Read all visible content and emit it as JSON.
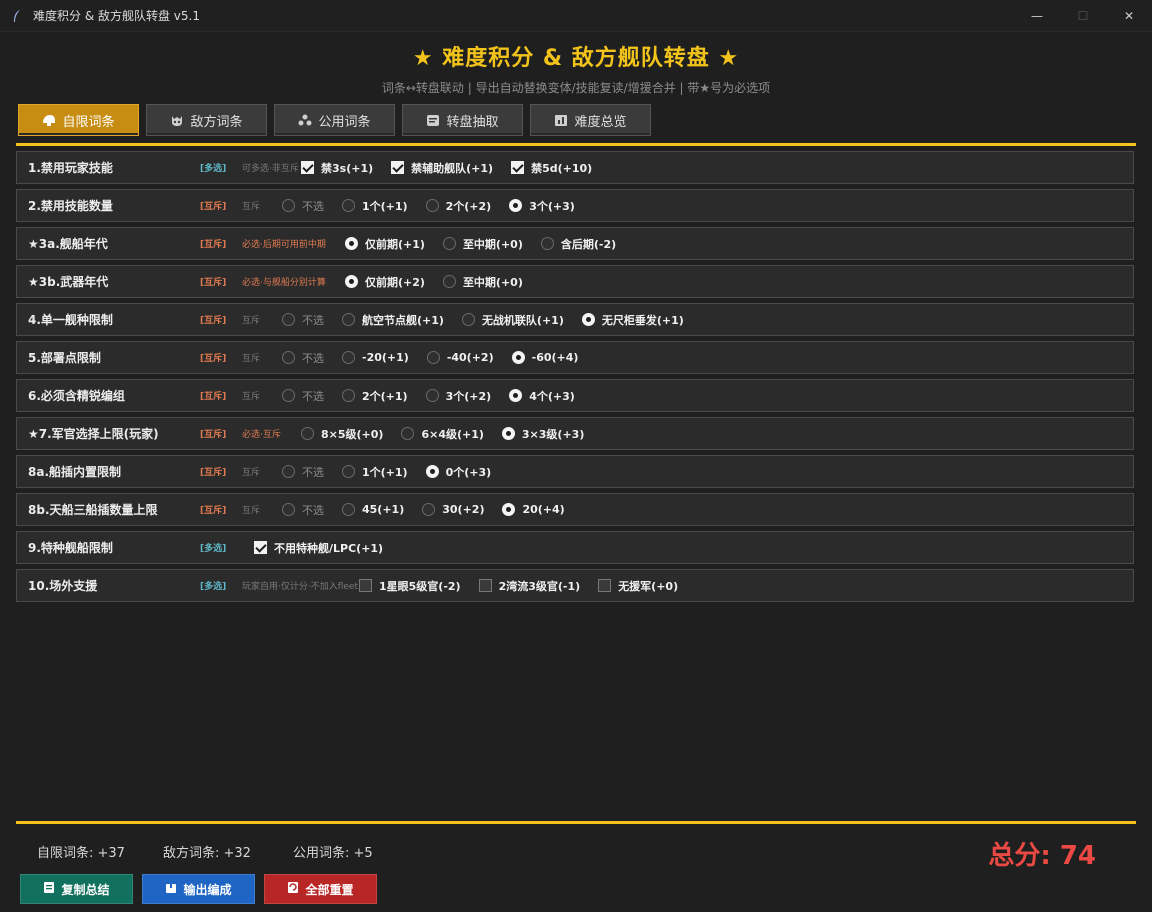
{
  "window": {
    "title": "难度积分 & 敌方舰队转盘 v5.1"
  },
  "header": {
    "title": "★ 难度积分 & 敌方舰队转盘 ★",
    "subtitle": "词条↔转盘联动 | 导出自动替换变体/技能复读/增援合并 | 带★号为必选项"
  },
  "tabs": [
    {
      "label": "自限词条",
      "icon": "helmet-icon",
      "active": true
    },
    {
      "label": "敌方词条",
      "icon": "skull-icon",
      "active": false
    },
    {
      "label": "公用词条",
      "icon": "puzzle-icon",
      "active": false
    },
    {
      "label": "转盘抽取",
      "icon": "dice-icon",
      "active": false
    },
    {
      "label": "难度总览",
      "icon": "chart-icon",
      "active": false
    }
  ],
  "rows": [
    {
      "label": "1.禁用玩家技能",
      "tag": "[多选]",
      "tag_type": "multi",
      "note": "可多选·非互斥",
      "note_req": false,
      "type": "check",
      "options": [
        {
          "label": "禁3s(+1)",
          "on": true
        },
        {
          "label": "禁辅助舰队(+1)",
          "on": true
        },
        {
          "label": "禁5d(+10)",
          "on": true
        }
      ]
    },
    {
      "label": "2.禁用技能数量",
      "tag": "[互斥]",
      "tag_type": "mutex",
      "note": "互斥",
      "note_req": false,
      "type": "radio",
      "options": [
        {
          "label": "不选",
          "on": false,
          "muted": true
        },
        {
          "label": "1个(+1)",
          "on": false
        },
        {
          "label": "2个(+2)",
          "on": false
        },
        {
          "label": "3个(+3)",
          "on": true
        }
      ]
    },
    {
      "label": "★3a.舰船年代",
      "tag": "[互斥]",
      "tag_type": "mutex",
      "note": "必选·后期可用前中期",
      "note_req": true,
      "type": "radio",
      "options": [
        {
          "label": "仅前期(+1)",
          "on": true
        },
        {
          "label": "至中期(+0)",
          "on": false
        },
        {
          "label": "含后期(-2)",
          "on": false
        }
      ]
    },
    {
      "label": "★3b.武器年代",
      "tag": "[互斥]",
      "tag_type": "mutex",
      "note": "必选·与舰船分别计算",
      "note_req": true,
      "type": "radio",
      "options": [
        {
          "label": "仅前期(+2)",
          "on": true
        },
        {
          "label": "至中期(+0)",
          "on": false
        }
      ]
    },
    {
      "label": "4.单一舰种限制",
      "tag": "[互斥]",
      "tag_type": "mutex",
      "note": "互斥",
      "note_req": false,
      "type": "radio",
      "options": [
        {
          "label": "不选",
          "on": false,
          "muted": true
        },
        {
          "label": "航空节点舰(+1)",
          "on": false
        },
        {
          "label": "无战机联队(+1)",
          "on": false
        },
        {
          "label": "无尺柜垂发(+1)",
          "on": true
        }
      ]
    },
    {
      "label": "5.部署点限制",
      "tag": "[互斥]",
      "tag_type": "mutex",
      "note": "互斥",
      "note_req": false,
      "type": "radio",
      "options": [
        {
          "label": "不选",
          "on": false,
          "muted": true
        },
        {
          "label": "-20(+1)",
          "on": false
        },
        {
          "label": "-40(+2)",
          "on": false
        },
        {
          "label": "-60(+4)",
          "on": true
        }
      ]
    },
    {
      "label": "6.必须含精锐编组",
      "tag": "[互斥]",
      "tag_type": "mutex",
      "note": "互斥",
      "note_req": false,
      "type": "radio",
      "options": [
        {
          "label": "不选",
          "on": false,
          "muted": true
        },
        {
          "label": "2个(+1)",
          "on": false
        },
        {
          "label": "3个(+2)",
          "on": false
        },
        {
          "label": "4个(+3)",
          "on": true
        }
      ]
    },
    {
      "label": "★7.军官选择上限(玩家)",
      "tag": "[互斥]",
      "tag_type": "mutex",
      "note": "必选·互斥",
      "note_req": true,
      "type": "radio",
      "options": [
        {
          "label": "8×5级(+0)",
          "on": false
        },
        {
          "label": "6×4级(+1)",
          "on": false
        },
        {
          "label": "3×3级(+3)",
          "on": true
        }
      ]
    },
    {
      "label": "8a.船插内置限制",
      "tag": "[互斥]",
      "tag_type": "mutex",
      "note": "互斥",
      "note_req": false,
      "type": "radio",
      "options": [
        {
          "label": "不选",
          "on": false,
          "muted": true
        },
        {
          "label": "1个(+1)",
          "on": false
        },
        {
          "label": "0个(+3)",
          "on": true
        }
      ]
    },
    {
      "label": "8b.天船三船插数量上限",
      "tag": "[互斥]",
      "tag_type": "mutex",
      "note": "互斥",
      "note_req": false,
      "type": "radio",
      "options": [
        {
          "label": "不选",
          "on": false,
          "muted": true
        },
        {
          "label": "45(+1)",
          "on": false
        },
        {
          "label": "30(+2)",
          "on": false
        },
        {
          "label": "20(+4)",
          "on": true
        }
      ]
    },
    {
      "label": "9.特种舰船限制",
      "tag": "[多选]",
      "tag_type": "multi",
      "note": "",
      "note_req": false,
      "type": "check",
      "options": [
        {
          "label": "不用特种舰/LPC(+1)",
          "on": true
        }
      ]
    },
    {
      "label": "10.场外支援",
      "tag": "[多选]",
      "tag_type": "multi",
      "note": "玩家自用·仅计分·不加入fleet",
      "note_req": false,
      "type": "check",
      "options": [
        {
          "label": "1星眼5级官(-2)",
          "on": false
        },
        {
          "label": "2湾流3级官(-1)",
          "on": false
        },
        {
          "label": "无援军(+0)",
          "on": false
        }
      ]
    }
  ],
  "footer": {
    "sum_self": "自限词条: +37",
    "sum_enemy": "敌方词条: +32",
    "sum_common": "公用词条: +5",
    "total": "总分: 74",
    "buttons": {
      "copy": "复制总结",
      "export": "输出编成",
      "reset": "全部重置"
    }
  },
  "colors": {
    "accent": "#f2c41b",
    "tab_active": "#c68d12",
    "total": "#ea4a43",
    "copy": "#12705e",
    "export": "#1f66c4",
    "reset": "#b82626"
  }
}
